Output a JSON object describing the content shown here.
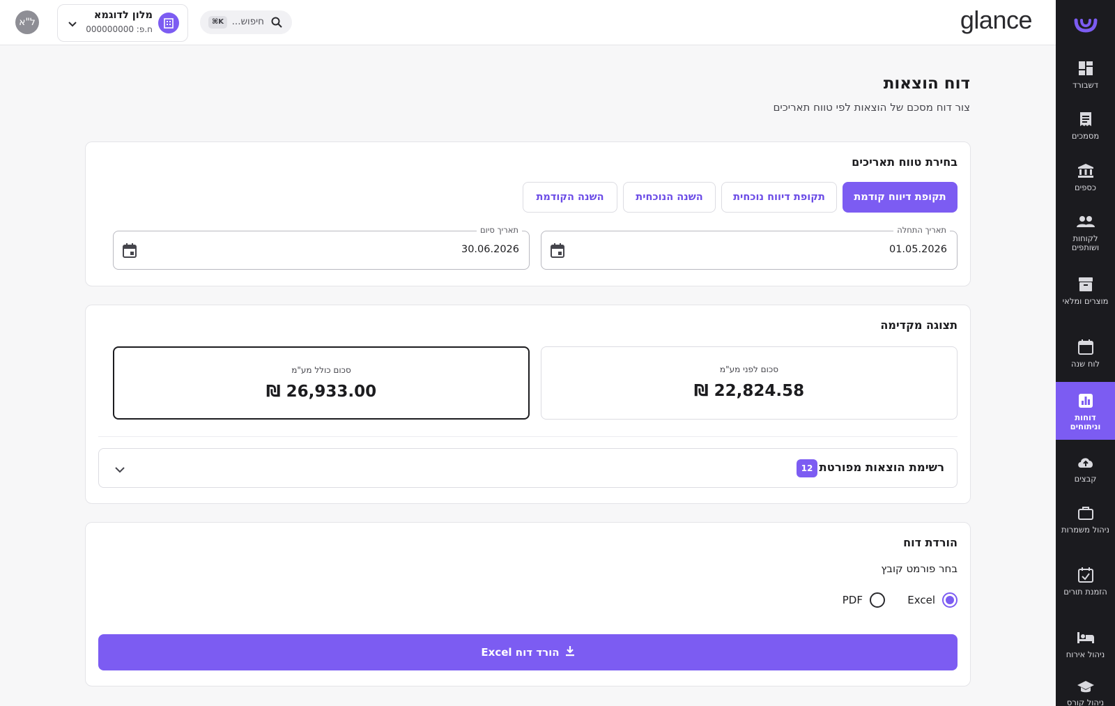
{
  "brand": "glance",
  "user": {
    "initials": "ל\"א"
  },
  "org": {
    "name": "מלון לדוגמא",
    "id_label": "ח.פ: 000000000"
  },
  "search": {
    "placeholder": "חיפוש...",
    "shortcut": "⌘K"
  },
  "sidebar": {
    "items": [
      {
        "label": "דשבורד",
        "icon": "dashboard-icon"
      },
      {
        "label": "מסמכים",
        "icon": "document-icon"
      },
      {
        "label": "כספים",
        "icon": "bank-icon"
      },
      {
        "label": "לקוחות ושותפים",
        "icon": "people-icon"
      },
      {
        "label": "מוצרים ומלאי",
        "icon": "archive-icon"
      },
      {
        "label": "לוח שנה",
        "icon": "calendar-icon"
      },
      {
        "label": "דוחות וניתוחים",
        "icon": "report-icon",
        "active": true
      },
      {
        "label": "קבצים",
        "icon": "cloud-upload-icon"
      },
      {
        "label": "ניהול משמרות",
        "icon": "briefcase-icon"
      },
      {
        "label": "הזמנת תורים",
        "icon": "calendar-check-icon"
      },
      {
        "label": "ניהול אירוח",
        "icon": "bed-icon"
      },
      {
        "label": "ניהול קורס",
        "icon": "graduation-icon"
      }
    ]
  },
  "page": {
    "title": "דוח הוצאות",
    "subtitle": "צור דוח מסכם של הוצאות לפי טווח תאריכים"
  },
  "date_range": {
    "title": "בחירת טווח תאריכים",
    "buttons": [
      "תקופת דיווח קודמת",
      "תקופת דיווח נוכחית",
      "השנה הנוכחית",
      "השנה הקודמת"
    ],
    "start": {
      "label": "תאריך התחלה",
      "value": "01.05.2026"
    },
    "end": {
      "label": "תאריך סיום",
      "value": "30.06.2026"
    }
  },
  "preview": {
    "title": "תצוגה מקדימה",
    "before_vat": {
      "label": "סכום לפני מע\"מ",
      "value": "22,824.58 ₪"
    },
    "incl_vat": {
      "label": "סכום כולל מע\"מ",
      "value": "26,933.00 ₪"
    },
    "list": {
      "title": "רשימת הוצאות מפורטת",
      "count": "12"
    }
  },
  "download": {
    "title": "הורדת דוח",
    "format_label": "בחר פורמט קובץ",
    "formats": [
      "Excel",
      "PDF"
    ],
    "selected": "Excel",
    "button_label": "הורד דוח Excel"
  },
  "colors": {
    "accent": "#7c5cf2",
    "sidebar_bg": "#1b1b1f"
  }
}
